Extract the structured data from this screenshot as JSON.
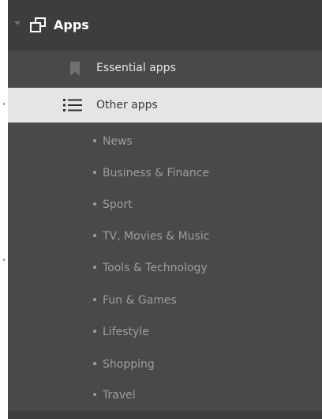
{
  "nav": {
    "section_title": "Apps",
    "section_icon": "window-stack-icon",
    "items": [
      {
        "label": "Essential apps",
        "icon": "bookmark-icon"
      },
      {
        "label": "Other apps",
        "icon": "list-icon",
        "selected": true
      }
    ],
    "subitems": [
      "News",
      "Business & Finance",
      "Sport",
      "TV, Movies & Music",
      "Tools & Technology",
      "Fun & Games",
      "Lifestyle",
      "Shopping",
      "Travel"
    ]
  },
  "colors": {
    "panel_bg": "#494949",
    "header_bg": "#3d3d3d",
    "selected_bg": "#e5e5e5",
    "subitem_text": "#9d9d9d"
  }
}
